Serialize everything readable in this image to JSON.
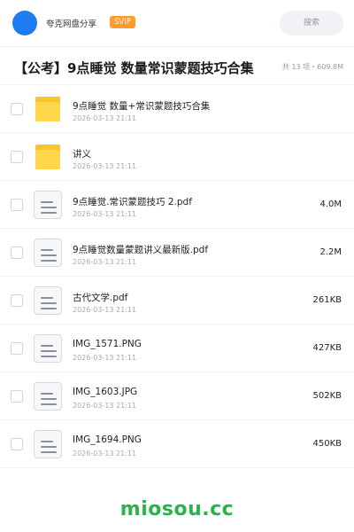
{
  "header": {
    "brand": "夸克网盘分享",
    "badge": "SVIP",
    "search_placeholder": "搜索",
    "avatar_color": "#1e7cf2"
  },
  "share": {
    "title": "【公考】9点睡觉 数量常识蒙题技巧合集",
    "meta": "共 13 项・609.8M"
  },
  "files": [
    {
      "type": "folder",
      "icon": "folder-icon",
      "name": "9点睡觉 数量+常识蒙题技巧合集",
      "date": "2026-03-13 21:11",
      "size": ""
    },
    {
      "type": "folder",
      "icon": "folder-icon",
      "name": "讲义",
      "date": "2026-03-13 21:11",
      "size": ""
    },
    {
      "type": "file",
      "icon": "document-icon",
      "name": "9点睡觉.常识蒙题技巧 2.pdf",
      "date": "2026-03-13 21:11",
      "size": "4.0M"
    },
    {
      "type": "file",
      "icon": "document-icon",
      "name": "9点睡觉数量蒙题讲义最新版.pdf",
      "date": "2026-03-13 21:11",
      "size": "2.2M"
    },
    {
      "type": "file",
      "icon": "document-icon",
      "name": "古代文学.pdf",
      "date": "2026-03-13 21:11",
      "size": "261KB"
    },
    {
      "type": "file",
      "icon": "document-icon",
      "name": "IMG_1571.PNG",
      "date": "2026-03-13 21:11",
      "size": "427KB"
    },
    {
      "type": "file",
      "icon": "document-icon",
      "name": "IMG_1603.JPG",
      "date": "2026-03-13 21:11",
      "size": "502KB"
    },
    {
      "type": "file",
      "icon": "document-icon",
      "name": "IMG_1694.PNG",
      "date": "2026-03-13 21:11",
      "size": "450KB"
    }
  ],
  "watermark": {
    "text": "miosou.cc",
    "color": "#2db24a"
  },
  "colors": {
    "badge": "#ff9a2e",
    "folder": "#ffd54a"
  }
}
